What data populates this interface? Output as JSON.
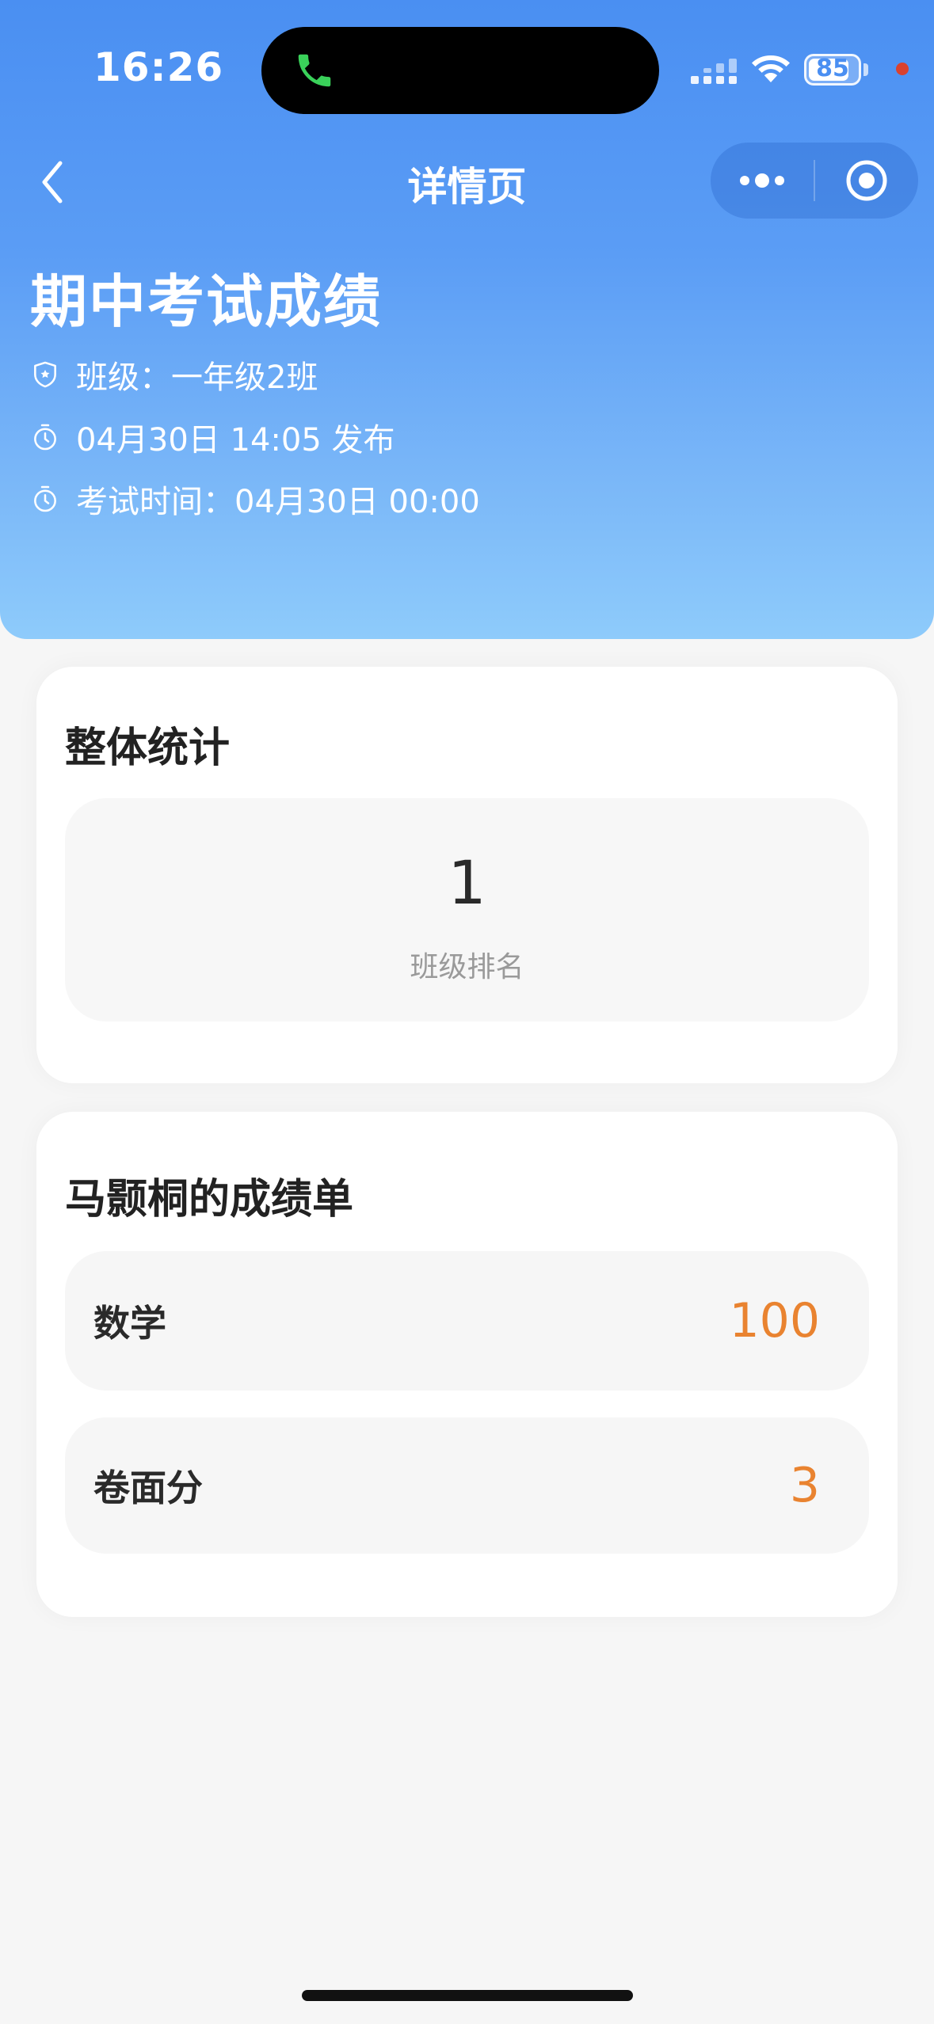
{
  "status_bar": {
    "time": "16:26",
    "battery": "85",
    "battery_level": 0.85
  },
  "nav": {
    "title": "详情页",
    "back_icon": "chevron-left-icon",
    "more_icon": "more-dots-icon",
    "close_icon": "target-circle-icon"
  },
  "exam": {
    "title": "期中考试成绩",
    "class": "班级：一年级2班",
    "published": "04月30日 14:05 发布",
    "exam_time": "考试时间：04月30日 00:00"
  },
  "stats": {
    "title": "整体统计",
    "rank_value": "1",
    "rank_label": "班级排名"
  },
  "scores": {
    "title": "马颢桐的成绩单",
    "items": [
      {
        "subject": "数学",
        "score": "100"
      },
      {
        "subject": "卷面分",
        "score": "3"
      }
    ]
  },
  "colors": {
    "header_top": "#4a8ff2",
    "header_bottom": "#8ecbfb",
    "score_accent": "#e98330",
    "page_bg": "#f6f6f6"
  }
}
